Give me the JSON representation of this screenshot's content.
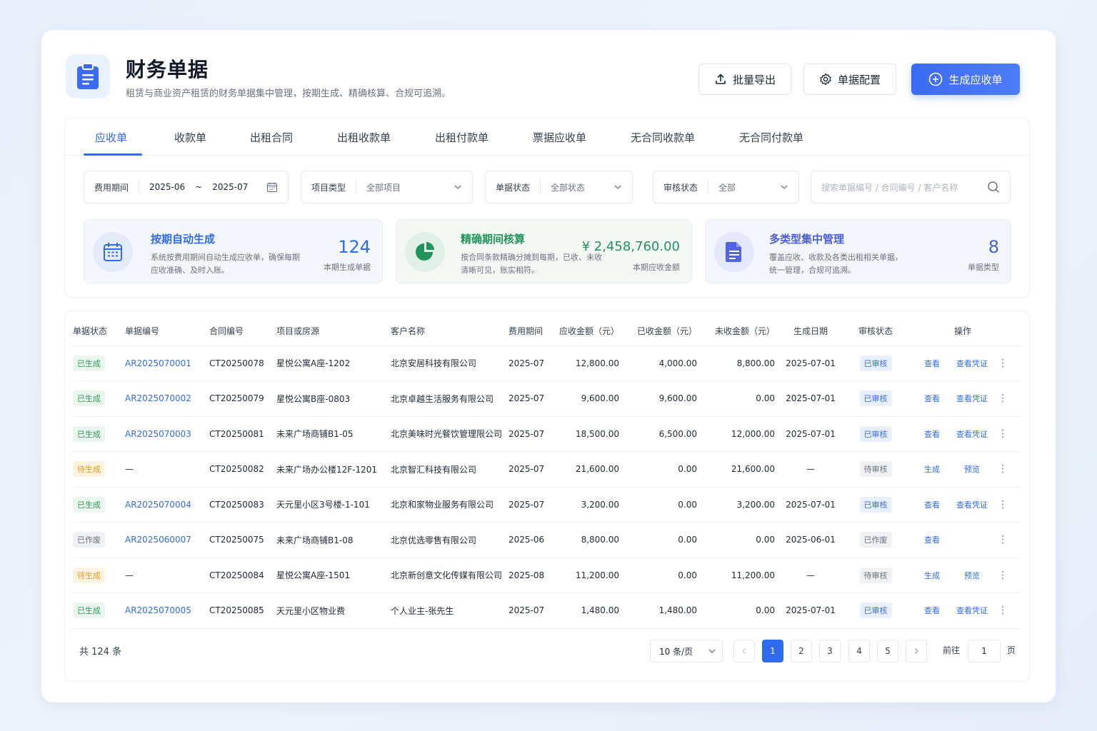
{
  "header": {
    "title": "财务单据",
    "subtitle": "租赁与商业资产租赁的财务单据集中管理，按期生成、精确核算、合规可追溯。",
    "export_label": "批量导出",
    "config_label": "单据配置",
    "create_label": "生成应收单"
  },
  "tabs": [
    "应收单",
    "收款单",
    "出租合同",
    "出租收款单",
    "出租付款单",
    "票据应收单",
    "无合同收款单",
    "无合同付款单"
  ],
  "filters": {
    "period_label": "费用期间",
    "period_start": "2025-06",
    "period_sep": "~",
    "period_end": "2025-07",
    "project_label": "项目类型",
    "project_value": "全部项目",
    "status_label": "单据状态",
    "status_value": "全部状态",
    "audit_label": "审核状态",
    "audit_value": "全部",
    "search_placeholder": "搜索单据编号 / 合同编号 / 客户名称"
  },
  "stats": [
    {
      "title": "按期自动生成",
      "desc1": "系统按费用期间自动生成应收单，确保每期",
      "desc2": "应收准确、及时入账。",
      "value": "124",
      "value_label": "本期生成单据",
      "color": "#2f6bef"
    },
    {
      "title": "精确期间核算",
      "desc1": "按合同条款精确分摊到每期，已收、未收",
      "desc2": "清晰可见，账实相符。",
      "value": "¥ 2,458,760.00",
      "value_label": "本期应收金额",
      "color": "#22935a"
    },
    {
      "title": "多类型集中管理",
      "desc1": "覆盖应收、收款及各类出租相关单据，",
      "desc2": "统一管理，合规可追溯。",
      "value": "8",
      "value_label": "单据类型",
      "color": "#4a5fd6"
    }
  ],
  "table": {
    "headers": [
      "单据状态",
      "单据编号",
      "合同编号",
      "项目或房源",
      "客户名称",
      "费用期间",
      "应收金额（元）",
      "已收金额（元）",
      "未收金额（元）",
      "生成日期",
      "审核状态",
      "操作"
    ],
    "rows": [
      {
        "status": "已生成",
        "no": "AR2025070001",
        "contract": "CT20250078",
        "project": "星悦公寓A座-1202",
        "customer": "北京安居科技有限公司",
        "period": "2025-07",
        "due": "12,800.00",
        "received": "4,000.00",
        "unpaid": "8,800.00",
        "date": "2025-07-01",
        "audit": "已审核",
        "op1": "查看",
        "op2": "查看凭证"
      },
      {
        "status": "已生成",
        "no": "AR2025070002",
        "contract": "CT20250079",
        "project": "星悦公寓B座-0803",
        "customer": "北京卓越生活服务有限公司",
        "period": "2025-07",
        "due": "9,600.00",
        "received": "9,600.00",
        "unpaid": "0.00",
        "date": "2025-07-01",
        "audit": "已审核",
        "op1": "查看",
        "op2": "查看凭证"
      },
      {
        "status": "已生成",
        "no": "AR2025070003",
        "contract": "CT20250081",
        "project": "未来广场商铺B1-05",
        "customer": "北京美味时光餐饮管理限公司",
        "period": "2025-07",
        "due": "18,500.00",
        "received": "6,500.00",
        "unpaid": "12,000.00",
        "date": "2025-07-01",
        "audit": "已审核",
        "op1": "查看",
        "op2": "查看凭证"
      },
      {
        "status": "待生成",
        "no": "—",
        "contract": "CT20250082",
        "project": "未来广场办公楼12F-1201",
        "customer": "北京智汇科技有限公司",
        "period": "2025-07",
        "due": "21,600.00",
        "received": "0.00",
        "unpaid": "21,600.00",
        "date": "—",
        "audit": "待审核",
        "op1": "生成",
        "op2": "预览"
      },
      {
        "status": "已生成",
        "no": "AR2025070004",
        "contract": "CT20250083",
        "project": "天元里小区3号楼-1-101",
        "customer": "北京和家物业服务有限公司",
        "period": "2025-07",
        "due": "3,200.00",
        "received": "0.00",
        "unpaid": "3,200.00",
        "date": "2025-07-01",
        "audit": "已审核",
        "op1": "查看",
        "op2": "查看凭证"
      },
      {
        "status": "已作废",
        "no": "AR2025060007",
        "contract": "CT20250075",
        "project": "未来广场商铺B1-08",
        "customer": "北京优选零售有限公司",
        "period": "2025-06",
        "due": "8,800.00",
        "received": "0.00",
        "unpaid": "0.00",
        "date": "2025-06-01",
        "audit": "已作废",
        "op1": "查看",
        "op2": ""
      },
      {
        "status": "待生成",
        "no": "—",
        "contract": "CT20250084",
        "project": "星悦公寓A座-1501",
        "customer": "北京新创意文化传媒有限公司",
        "period": "2025-08",
        "due": "11,200.00",
        "received": "0.00",
        "unpaid": "11,200.00",
        "date": "—",
        "audit": "待审核",
        "op1": "生成",
        "op2": "预览"
      },
      {
        "status": "已生成",
        "no": "AR2025070005",
        "contract": "CT20250085",
        "project": "天元里小区物业费",
        "customer": "个人业主-张先生",
        "period": "2025-07",
        "due": "1,480.00",
        "received": "1,480.00",
        "unpaid": "0.00",
        "date": "2025-07-01",
        "audit": "已审核",
        "op1": "查看",
        "op2": "查看凭证"
      }
    ]
  },
  "pagination": {
    "total": "共 124 条",
    "page_size": "10 条/页",
    "pages": [
      "1",
      "2",
      "3",
      "4",
      "5"
    ],
    "current": "1",
    "goto_label": "前往",
    "goto_value": "1",
    "page_unit": "页"
  },
  "colors": {
    "primary": "#2f6bef",
    "success": "#2f9b5a",
    "warning": "#e59a26"
  }
}
